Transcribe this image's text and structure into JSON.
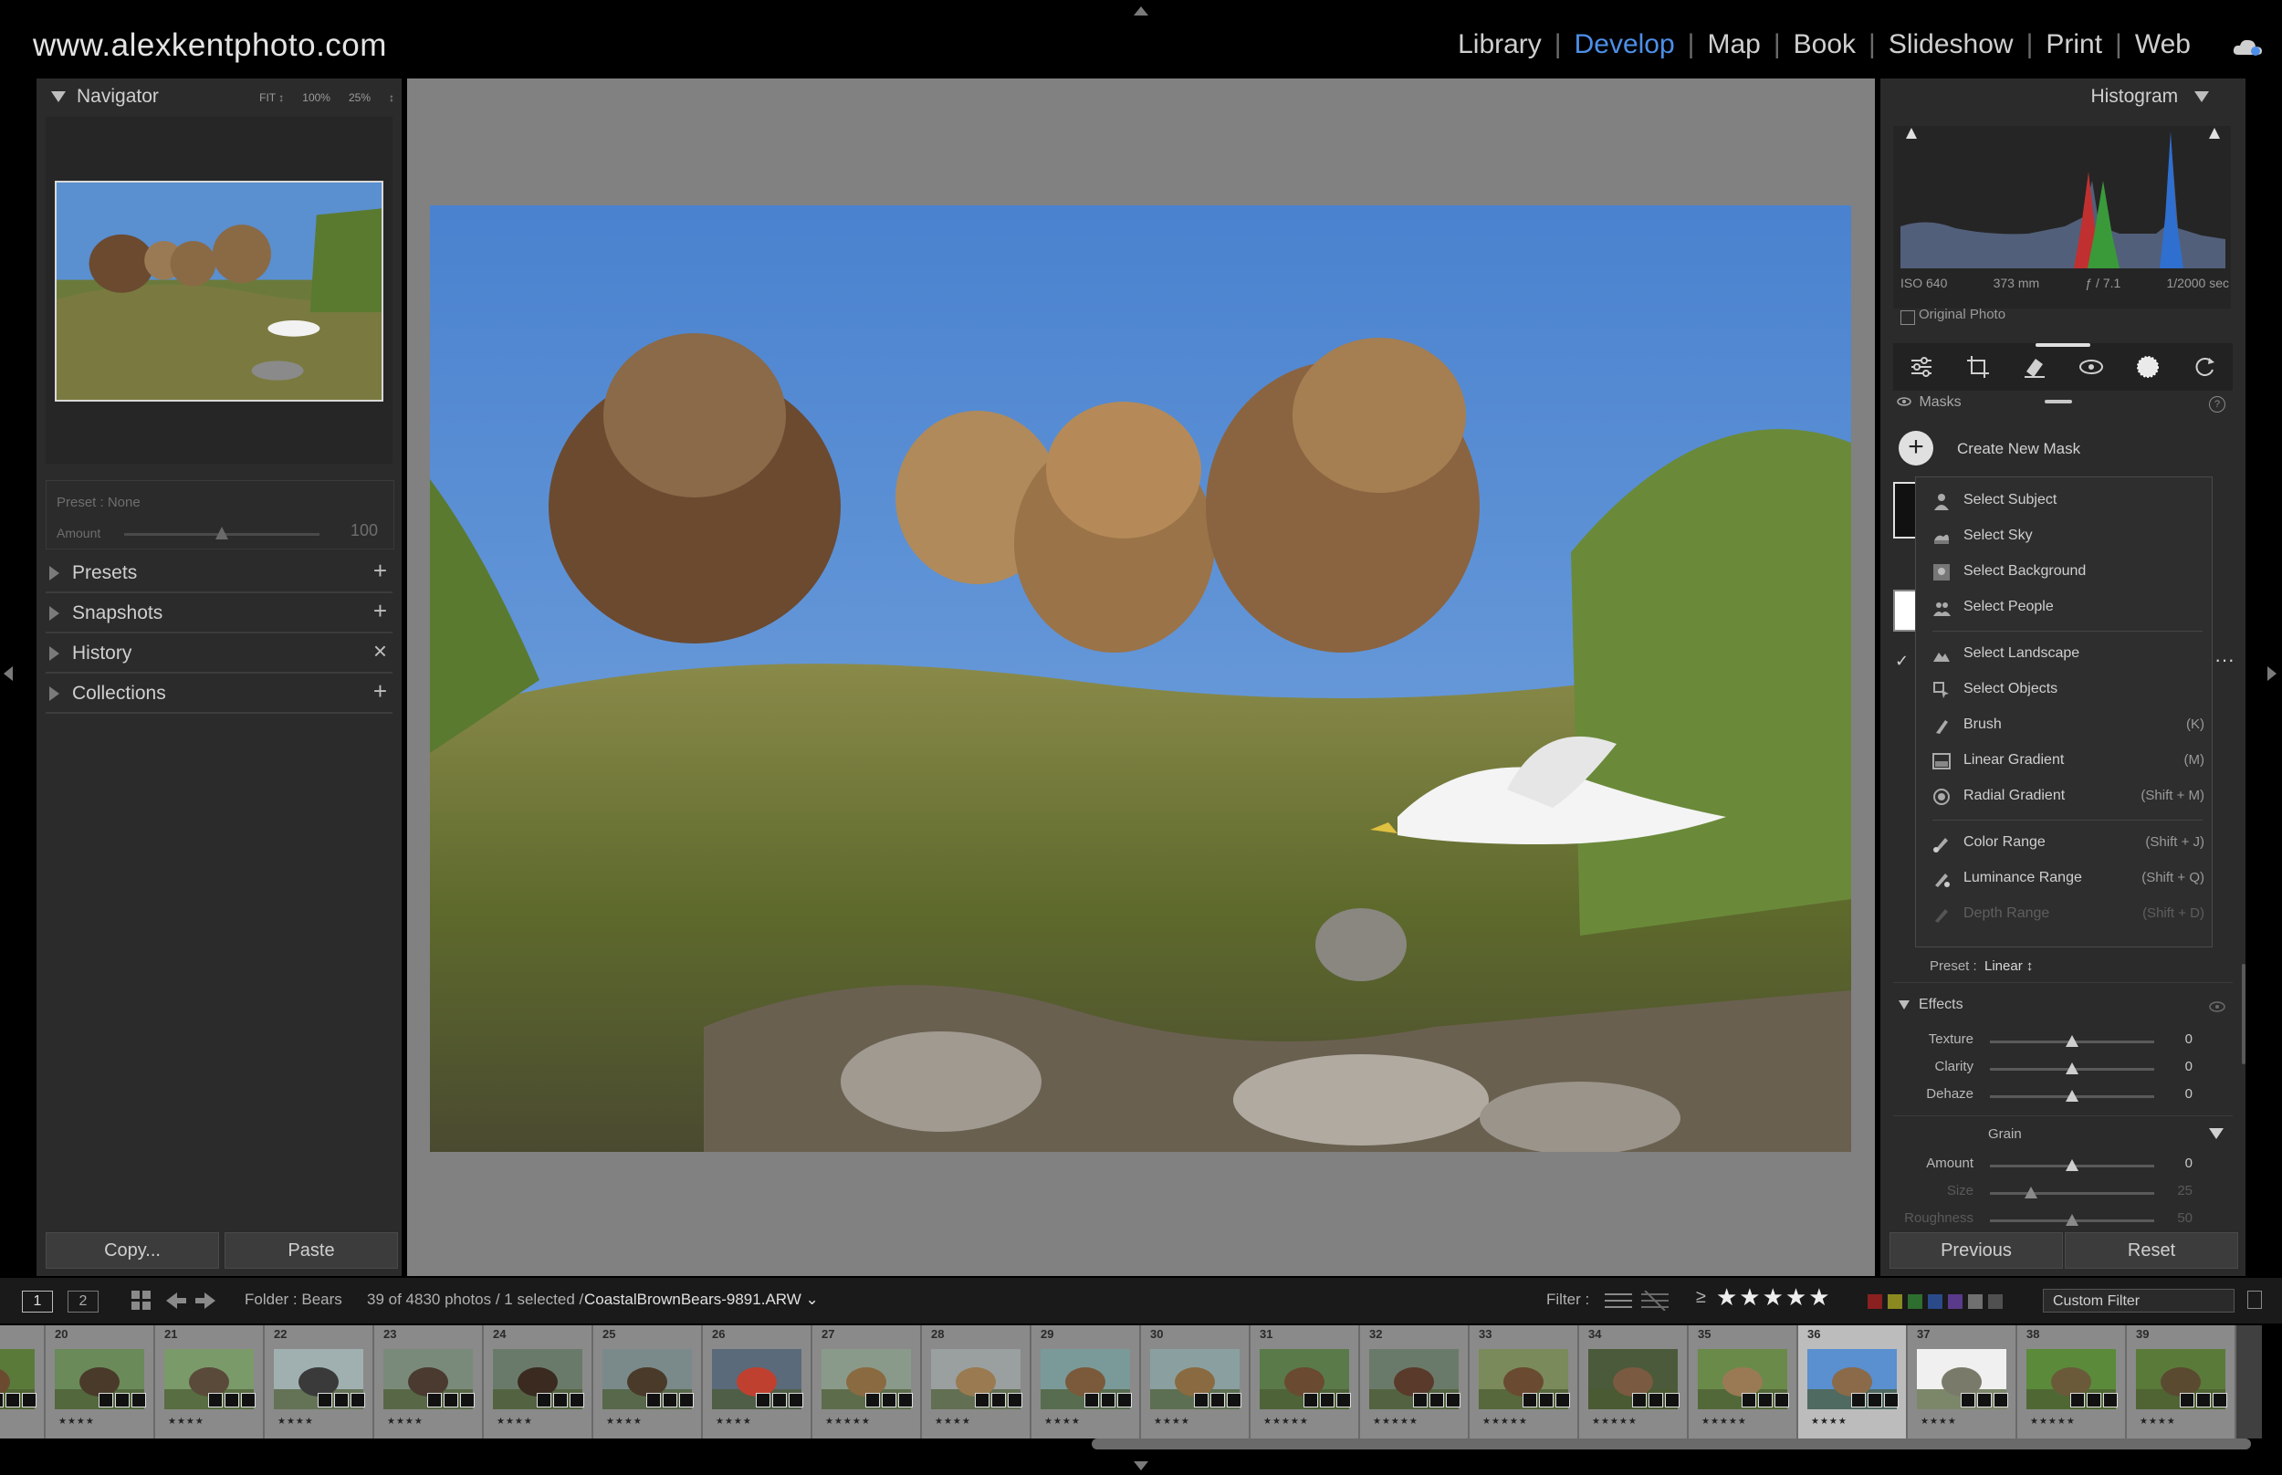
{
  "brand": "www.alexkentphoto.com",
  "modules": [
    {
      "label": "Library",
      "active": false
    },
    {
      "label": "Develop",
      "active": true
    },
    {
      "label": "Map",
      "active": false
    },
    {
      "label": "Book",
      "active": false
    },
    {
      "label": "Slideshow",
      "active": false
    },
    {
      "label": "Print",
      "active": false
    },
    {
      "label": "Web",
      "active": false
    }
  ],
  "module_separator": "|",
  "left": {
    "navigator": {
      "title": "Navigator",
      "zoom": [
        "FIT ↕",
        "100%",
        "25%",
        "↕"
      ]
    },
    "preset": {
      "label": "Preset : None",
      "amount_label": "Amount",
      "amount_value": "100",
      "amount_fraction": 0.5
    },
    "sections": [
      {
        "label": "Presets",
        "action": "+"
      },
      {
        "label": "Snapshots",
        "action": "+"
      },
      {
        "label": "History",
        "action": "×"
      },
      {
        "label": "Collections",
        "action": "+"
      }
    ],
    "copy_label": "Copy...",
    "paste_label": "Paste"
  },
  "right": {
    "histogram_title": "Histogram",
    "exif": [
      "ISO 640",
      "373 mm",
      "ƒ / 7.1",
      "1/2000 sec"
    ],
    "original_photo": "Original Photo",
    "masks_title": "Masks",
    "help": "?",
    "create_new_mask": "Create New Mask",
    "mask_menu": [
      {
        "label": "Select Subject",
        "key": "",
        "icon": "person-icon",
        "dim": false
      },
      {
        "label": "Select Sky",
        "key": "",
        "icon": "sky-icon",
        "dim": false
      },
      {
        "label": "Select Background",
        "key": "",
        "icon": "background-icon",
        "dim": false
      },
      {
        "label": "Select People",
        "key": "",
        "icon": "people-icon",
        "dim": false
      },
      {
        "label": "Select Landscape",
        "key": "",
        "icon": "landscape-icon",
        "dim": false
      },
      {
        "label": "Select Objects",
        "key": "",
        "icon": "objects-icon",
        "dim": false
      },
      {
        "label": "Brush",
        "key": "(K)",
        "icon": "brush-icon",
        "dim": false
      },
      {
        "label": "Linear Gradient",
        "key": "(M)",
        "icon": "linear-gradient-icon",
        "dim": false
      },
      {
        "label": "Radial Gradient",
        "key": "(Shift + M)",
        "icon": "radial-gradient-icon",
        "dim": false
      },
      {
        "label": "Color Range",
        "key": "(Shift + J)",
        "icon": "color-range-icon",
        "dim": false
      },
      {
        "label": "Luminance Range",
        "key": "(Shift + Q)",
        "icon": "luminance-range-icon",
        "dim": false
      },
      {
        "label": "Depth Range",
        "key": "(Shift + D)",
        "icon": "depth-range-icon",
        "dim": true
      }
    ],
    "preset_label": "Preset :",
    "preset_value": "Linear ↕",
    "effects_title": "Effects",
    "effects": [
      {
        "label": "Texture",
        "value": "0",
        "fraction": 0.5
      },
      {
        "label": "Clarity",
        "value": "0",
        "fraction": 0.5
      },
      {
        "label": "Dehaze",
        "value": "0",
        "fraction": 0.5
      }
    ],
    "grain_title": "Grain",
    "grain": [
      {
        "label": "Amount",
        "value": "0",
        "fraction": 0.5,
        "dim": false
      },
      {
        "label": "Size",
        "value": "25",
        "fraction": 0.25,
        "dim": true
      },
      {
        "label": "Roughness",
        "value": "50",
        "fraction": 0.5,
        "dim": true
      }
    ],
    "previous_label": "Previous",
    "reset_label": "Reset"
  },
  "filmbar": {
    "view1": "1",
    "view2": "2",
    "folder": "Folder : Bears",
    "count": "39 of 4830 photos / 1 selected /",
    "filename": "CoastalBrownBears-9891.ARW ⌄",
    "filter_label": "Filter :",
    "rating_op": "≥",
    "rating_stars": "★★★★★",
    "custom_filter": "Custom Filter",
    "color_chips": [
      "#8a2020",
      "#8a8a20",
      "#2e6e2e",
      "#2a4a8a",
      "#5a3a8a",
      "#707070",
      "#505050"
    ]
  },
  "filmstrip": [
    {
      "num": "",
      "stars": ""
    },
    {
      "num": "20",
      "stars": "★★★★"
    },
    {
      "num": "21",
      "stars": "★★★★"
    },
    {
      "num": "22",
      "stars": "★★★★"
    },
    {
      "num": "23",
      "stars": "★★★★"
    },
    {
      "num": "24",
      "stars": "★★★★"
    },
    {
      "num": "25",
      "stars": "★★★★"
    },
    {
      "num": "26",
      "stars": "★★★★"
    },
    {
      "num": "27",
      "stars": "★★★★★"
    },
    {
      "num": "28",
      "stars": "★★★★"
    },
    {
      "num": "29",
      "stars": "★★★★"
    },
    {
      "num": "30",
      "stars": "★★★★"
    },
    {
      "num": "31",
      "stars": "★★★★★"
    },
    {
      "num": "32",
      "stars": "★★★★★"
    },
    {
      "num": "33",
      "stars": "★★★★★"
    },
    {
      "num": "34",
      "stars": "★★★★★"
    },
    {
      "num": "35",
      "stars": "★★★★★"
    },
    {
      "num": "36",
      "stars": "★★★★"
    },
    {
      "num": "37",
      "stars": "★★★★"
    },
    {
      "num": "38",
      "stars": "★★★★★"
    },
    {
      "num": "39",
      "stars": "★★★★"
    }
  ]
}
